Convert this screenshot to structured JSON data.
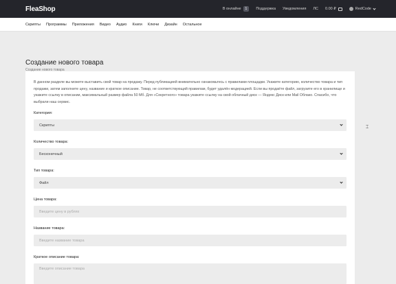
{
  "header": {
    "logo": "FleaShop",
    "online_label": "В онлайне",
    "online_count": "1",
    "support": "Поддержка",
    "notifications": "Уведомления",
    "messages": "ЛС",
    "balance": "0.00 ₽",
    "username": "RedCode"
  },
  "categories": [
    "Скрипты",
    "Программы",
    "Приложения",
    "Видео",
    "Аудио",
    "Книги",
    "Ключи",
    "Дизайн",
    "Остальное"
  ],
  "page": {
    "title": "Создание нового товара",
    "breadcrumb": "Создание нового товара"
  },
  "form": {
    "intro": "В данном разделе вы можете выставить свой товар на продажу. Перед публикацией внимательно ознакомьтесь с правилами площадки. Укажите категорию, количество товара и тип продажи, затем заполните цену, название и краткое описание. Товар, не соответствующий правилам, будет удалён модерацией. Если вы продаёте файл, загрузите его в хранилище и укажите ссылку в описании, максимальный размер файла 50 Мб. Для «Секретного» товара укажите ссылку на свой облачный диск — Яндекс Диск или Mail Облако. Спасибо, что выбрали наш сервис.",
    "category_label": "Категория:",
    "category_value": "Скрипты",
    "quantity_label": "Количество товара:",
    "quantity_value": "Бесконечный",
    "type_label": "Тип товара:",
    "type_value": "Файл",
    "price_label": "Цена товара:",
    "price_placeholder": "Введите цену в рублях",
    "name_label": "Название товара:",
    "name_placeholder": "Введите название товара",
    "desc_label": "Краткое описание товара:",
    "desc_placeholder": "Введите описание товара"
  }
}
